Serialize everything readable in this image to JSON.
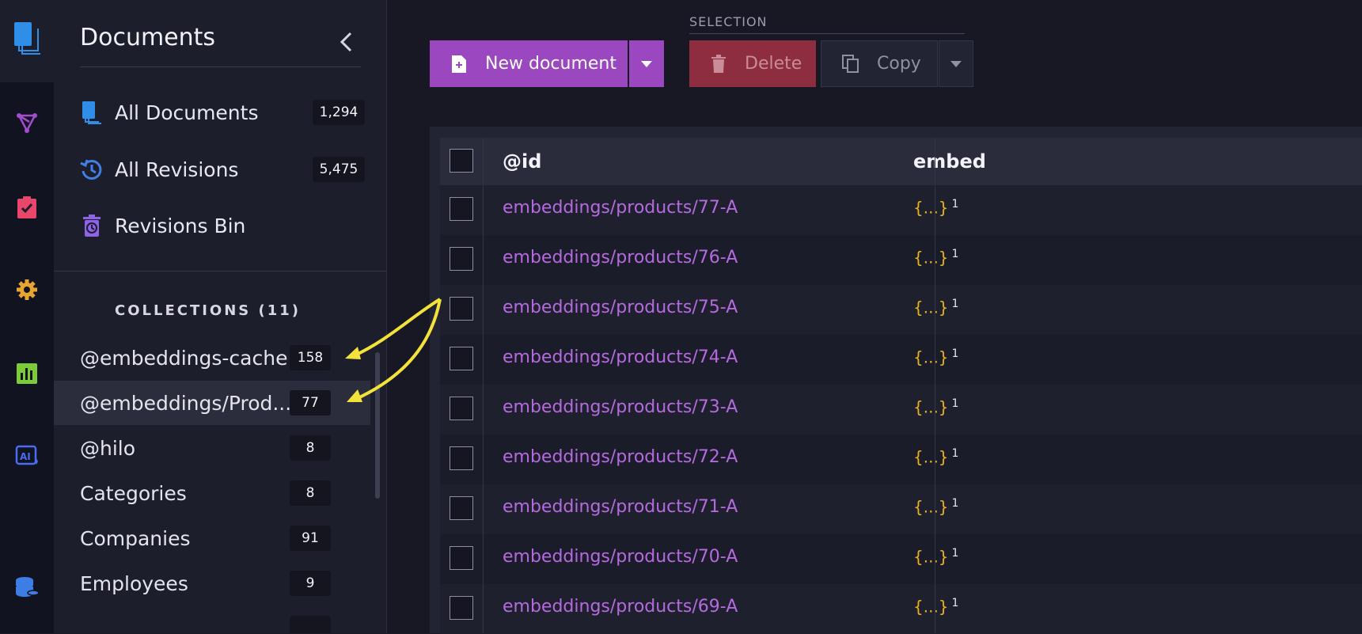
{
  "sidebar": {
    "title": "Documents",
    "nav": [
      {
        "label": "All Documents",
        "count": "1,294",
        "icon": "documents-icon"
      },
      {
        "label": "All Revisions",
        "count": "5,475",
        "icon": "revisions-icon"
      },
      {
        "label": "Revisions Bin",
        "count": "",
        "icon": "revisions-bin-icon"
      }
    ],
    "collections_heading": "COLLECTIONS (11)",
    "collections": [
      {
        "label": "@embeddings-cache",
        "count": "158"
      },
      {
        "label": "@embeddings/Prod...",
        "count": "77"
      },
      {
        "label": "@hilo",
        "count": "8"
      },
      {
        "label": "Categories",
        "count": "8"
      },
      {
        "label": "Companies",
        "count": "91"
      },
      {
        "label": "Employees",
        "count": "9"
      }
    ]
  },
  "toolbar": {
    "new_document": "New document",
    "selection_label": "SELECTION",
    "delete": "Delete",
    "copy": "Copy"
  },
  "grid": {
    "columns": [
      "@id",
      "embed"
    ],
    "rows": [
      {
        "id": "embeddings/products/77-A",
        "embed": "{...}",
        "count": "1"
      },
      {
        "id": "embeddings/products/76-A",
        "embed": "{...}",
        "count": "1"
      },
      {
        "id": "embeddings/products/75-A",
        "embed": "{...}",
        "count": "1"
      },
      {
        "id": "embeddings/products/74-A",
        "embed": "{...}",
        "count": "1"
      },
      {
        "id": "embeddings/products/73-A",
        "embed": "{...}",
        "count": "1"
      },
      {
        "id": "embeddings/products/72-A",
        "embed": "{...}",
        "count": "1"
      },
      {
        "id": "embeddings/products/71-A",
        "embed": "{...}",
        "count": "1"
      },
      {
        "id": "embeddings/products/70-A",
        "embed": "{...}",
        "count": "1"
      },
      {
        "id": "embeddings/products/69-A",
        "embed": "{...}",
        "count": "1"
      }
    ]
  },
  "colors": {
    "accent": "#9a47c0",
    "link": "#b56ae0",
    "embed": "#e8b21d",
    "annotation": "#f3e23a"
  }
}
